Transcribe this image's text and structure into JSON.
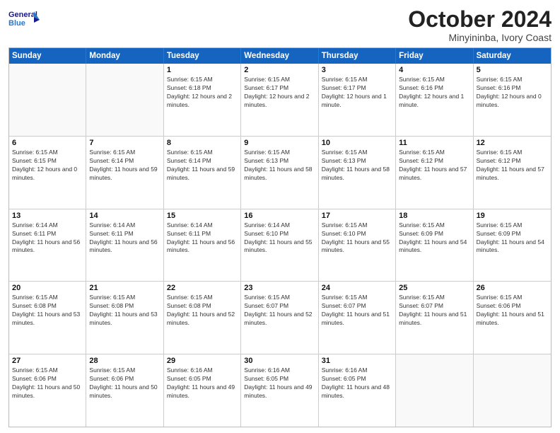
{
  "header": {
    "logo_line1": "General",
    "logo_line2": "Blue",
    "month": "October 2024",
    "location": "Minyininba, Ivory Coast"
  },
  "day_headers": [
    "Sunday",
    "Monday",
    "Tuesday",
    "Wednesday",
    "Thursday",
    "Friday",
    "Saturday"
  ],
  "weeks": [
    [
      {
        "day": "",
        "info": ""
      },
      {
        "day": "",
        "info": ""
      },
      {
        "day": "1",
        "info": "Sunrise: 6:15 AM\nSunset: 6:18 PM\nDaylight: 12 hours and 2 minutes."
      },
      {
        "day": "2",
        "info": "Sunrise: 6:15 AM\nSunset: 6:17 PM\nDaylight: 12 hours and 2 minutes."
      },
      {
        "day": "3",
        "info": "Sunrise: 6:15 AM\nSunset: 6:17 PM\nDaylight: 12 hours and 1 minute."
      },
      {
        "day": "4",
        "info": "Sunrise: 6:15 AM\nSunset: 6:16 PM\nDaylight: 12 hours and 1 minute."
      },
      {
        "day": "5",
        "info": "Sunrise: 6:15 AM\nSunset: 6:16 PM\nDaylight: 12 hours and 0 minutes."
      }
    ],
    [
      {
        "day": "6",
        "info": "Sunrise: 6:15 AM\nSunset: 6:15 PM\nDaylight: 12 hours and 0 minutes."
      },
      {
        "day": "7",
        "info": "Sunrise: 6:15 AM\nSunset: 6:14 PM\nDaylight: 11 hours and 59 minutes."
      },
      {
        "day": "8",
        "info": "Sunrise: 6:15 AM\nSunset: 6:14 PM\nDaylight: 11 hours and 59 minutes."
      },
      {
        "day": "9",
        "info": "Sunrise: 6:15 AM\nSunset: 6:13 PM\nDaylight: 11 hours and 58 minutes."
      },
      {
        "day": "10",
        "info": "Sunrise: 6:15 AM\nSunset: 6:13 PM\nDaylight: 11 hours and 58 minutes."
      },
      {
        "day": "11",
        "info": "Sunrise: 6:15 AM\nSunset: 6:12 PM\nDaylight: 11 hours and 57 minutes."
      },
      {
        "day": "12",
        "info": "Sunrise: 6:15 AM\nSunset: 6:12 PM\nDaylight: 11 hours and 57 minutes."
      }
    ],
    [
      {
        "day": "13",
        "info": "Sunrise: 6:14 AM\nSunset: 6:11 PM\nDaylight: 11 hours and 56 minutes."
      },
      {
        "day": "14",
        "info": "Sunrise: 6:14 AM\nSunset: 6:11 PM\nDaylight: 11 hours and 56 minutes."
      },
      {
        "day": "15",
        "info": "Sunrise: 6:14 AM\nSunset: 6:11 PM\nDaylight: 11 hours and 56 minutes."
      },
      {
        "day": "16",
        "info": "Sunrise: 6:14 AM\nSunset: 6:10 PM\nDaylight: 11 hours and 55 minutes."
      },
      {
        "day": "17",
        "info": "Sunrise: 6:15 AM\nSunset: 6:10 PM\nDaylight: 11 hours and 55 minutes."
      },
      {
        "day": "18",
        "info": "Sunrise: 6:15 AM\nSunset: 6:09 PM\nDaylight: 11 hours and 54 minutes."
      },
      {
        "day": "19",
        "info": "Sunrise: 6:15 AM\nSunset: 6:09 PM\nDaylight: 11 hours and 54 minutes."
      }
    ],
    [
      {
        "day": "20",
        "info": "Sunrise: 6:15 AM\nSunset: 6:08 PM\nDaylight: 11 hours and 53 minutes."
      },
      {
        "day": "21",
        "info": "Sunrise: 6:15 AM\nSunset: 6:08 PM\nDaylight: 11 hours and 53 minutes."
      },
      {
        "day": "22",
        "info": "Sunrise: 6:15 AM\nSunset: 6:08 PM\nDaylight: 11 hours and 52 minutes."
      },
      {
        "day": "23",
        "info": "Sunrise: 6:15 AM\nSunset: 6:07 PM\nDaylight: 11 hours and 52 minutes."
      },
      {
        "day": "24",
        "info": "Sunrise: 6:15 AM\nSunset: 6:07 PM\nDaylight: 11 hours and 51 minutes."
      },
      {
        "day": "25",
        "info": "Sunrise: 6:15 AM\nSunset: 6:07 PM\nDaylight: 11 hours and 51 minutes."
      },
      {
        "day": "26",
        "info": "Sunrise: 6:15 AM\nSunset: 6:06 PM\nDaylight: 11 hours and 51 minutes."
      }
    ],
    [
      {
        "day": "27",
        "info": "Sunrise: 6:15 AM\nSunset: 6:06 PM\nDaylight: 11 hours and 50 minutes."
      },
      {
        "day": "28",
        "info": "Sunrise: 6:15 AM\nSunset: 6:06 PM\nDaylight: 11 hours and 50 minutes."
      },
      {
        "day": "29",
        "info": "Sunrise: 6:16 AM\nSunset: 6:05 PM\nDaylight: 11 hours and 49 minutes."
      },
      {
        "day": "30",
        "info": "Sunrise: 6:16 AM\nSunset: 6:05 PM\nDaylight: 11 hours and 49 minutes."
      },
      {
        "day": "31",
        "info": "Sunrise: 6:16 AM\nSunset: 6:05 PM\nDaylight: 11 hours and 48 minutes."
      },
      {
        "day": "",
        "info": ""
      },
      {
        "day": "",
        "info": ""
      }
    ]
  ]
}
